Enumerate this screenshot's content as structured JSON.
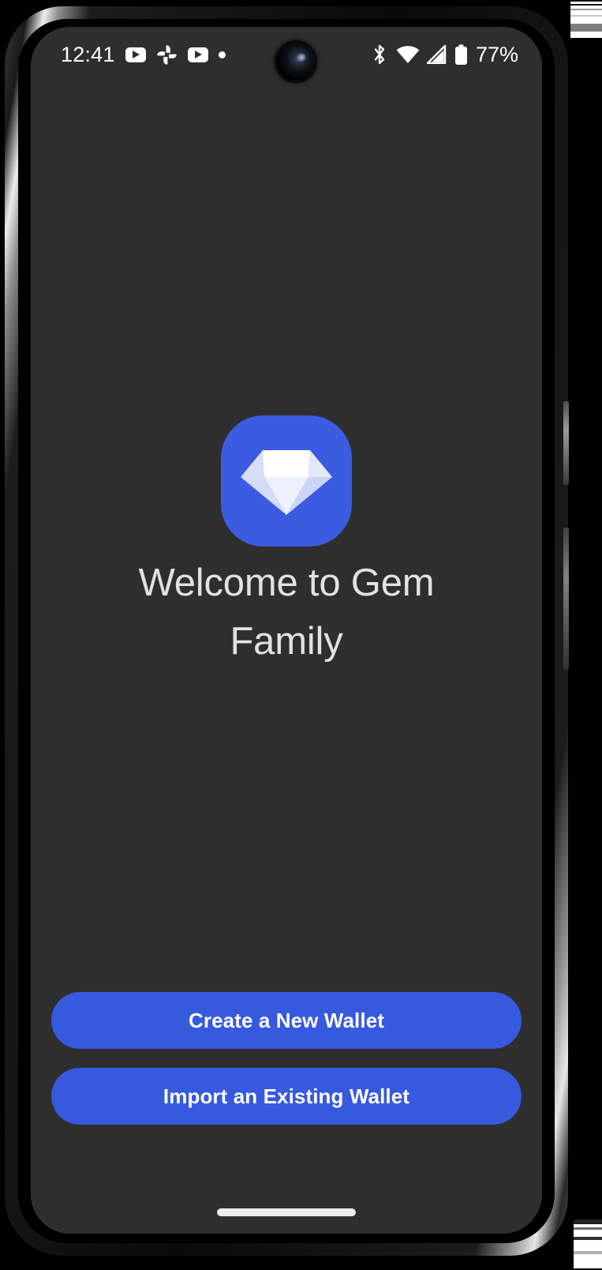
{
  "status_bar": {
    "time": "12:41",
    "battery_percent": "77%",
    "left_icons": [
      {
        "name": "youtube-notification-icon",
        "glyph": "youtube"
      },
      {
        "name": "google-photos-notification-icon",
        "glyph": "pinwheel"
      },
      {
        "name": "youtube-notification-icon-2",
        "glyph": "youtube"
      },
      {
        "name": "more-notifications-dot-icon",
        "glyph": "dot"
      }
    ],
    "right_icons": [
      {
        "name": "bluetooth-icon",
        "glyph": "bluetooth"
      },
      {
        "name": "wifi-icon",
        "glyph": "wifi"
      },
      {
        "name": "cellular-signal-icon",
        "glyph": "signal"
      },
      {
        "name": "battery-icon",
        "glyph": "battery"
      }
    ]
  },
  "app": {
    "logo_icon_name": "gem-diamond-icon",
    "title": "Welcome to Gem Family",
    "title_line_1": "Welcome to Gem",
    "title_line_2": "Family"
  },
  "buttons": {
    "create_wallet_label": "Create a New Wallet",
    "import_wallet_label": "Import an Existing Wallet"
  },
  "navigation": {
    "home_indicator": ""
  },
  "colors": {
    "background": "#2e2e2e",
    "accent_blue": "#3659de",
    "logo_blue": "#3b5ce0",
    "title_text": "#e2e2e4",
    "button_text": "#ffffff",
    "status_text": "#ffffff",
    "home_indicator": "#ececec"
  }
}
